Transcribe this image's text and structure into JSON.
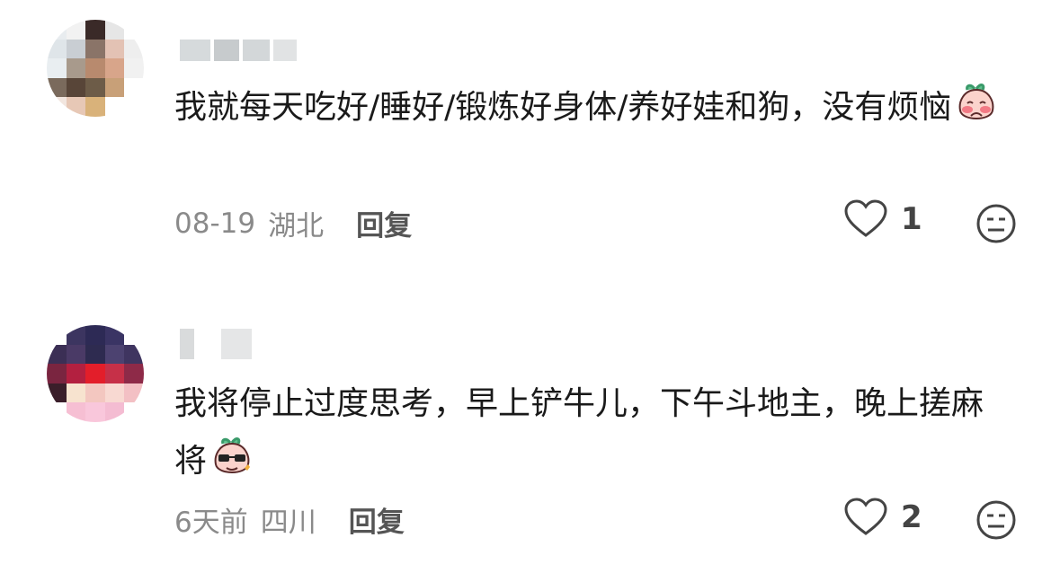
{
  "comments": [
    {
      "text": "我就每天吃好/睡好/锻炼好身体/养好娃和狗，没有烦恼",
      "emoji": "blush-peach-emoji",
      "date": "08-19",
      "location": "湖北",
      "reply_label": "回复",
      "likes": "1"
    },
    {
      "text": "我将停止过度思考，早上铲牛儿，下午斗地主，晚上搓麻将",
      "emoji": "sunglasses-peach-emoji",
      "date": "6天前",
      "location": "四川",
      "reply_label": "回复",
      "likes": "2"
    }
  ],
  "icons": {
    "like": "heart-outline-icon",
    "dislike": "meh-face-icon"
  },
  "colors": {
    "text": "#1a1a1a",
    "meta": "#8a8a8a",
    "reply": "#555555"
  }
}
